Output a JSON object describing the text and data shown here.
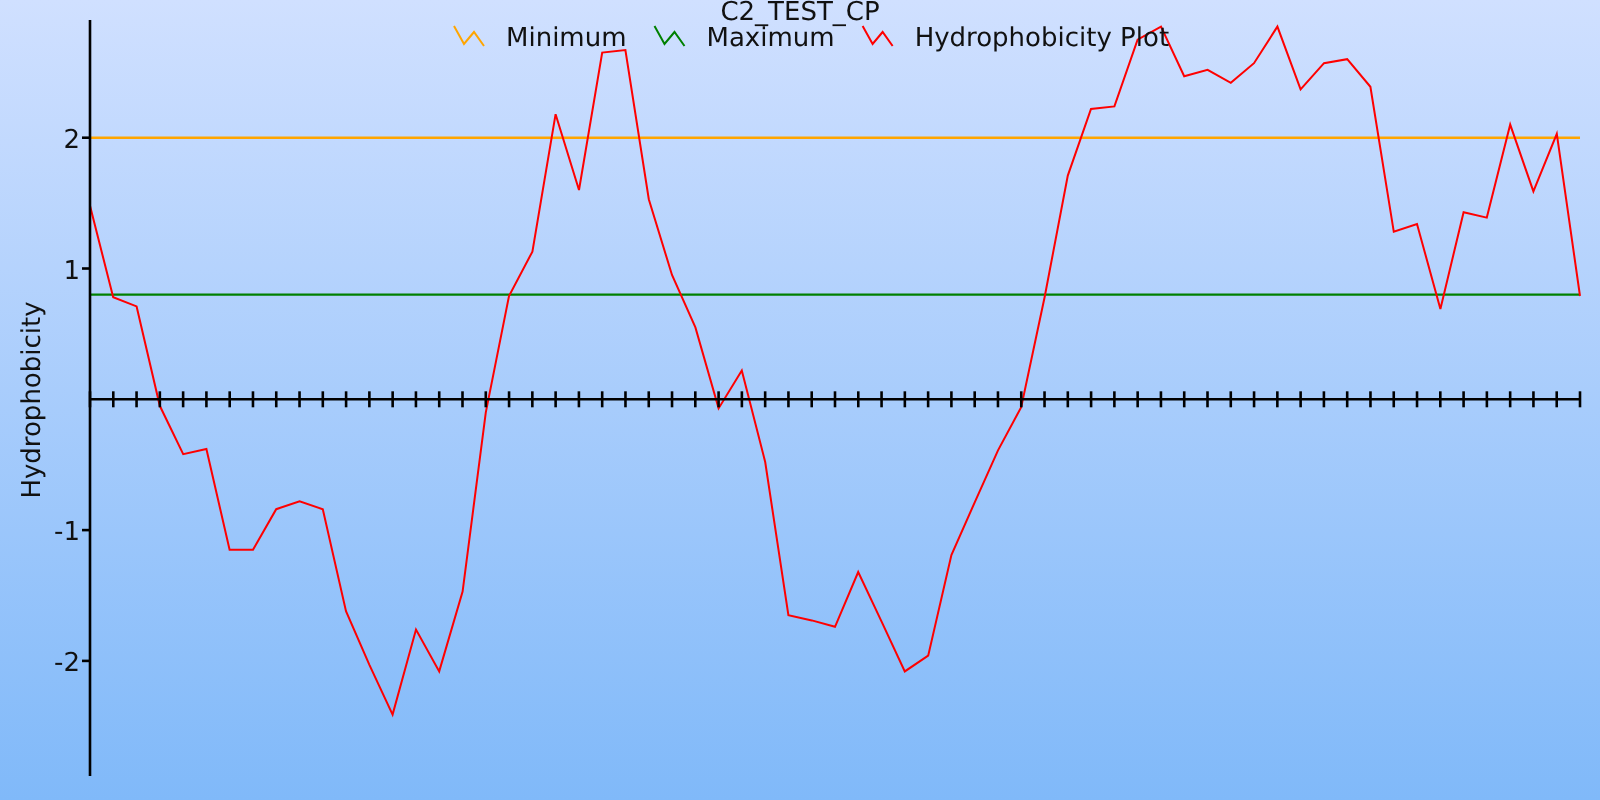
{
  "chart_data": {
    "type": "line",
    "title": "C2_TEST_CP",
    "ylabel": "Hydrophobicity",
    "categories": [
      null,
      null,
      null,
      null,
      null,
      null,
      null,
      null,
      null,
      null,
      null,
      null,
      null,
      null,
      null,
      null,
      null,
      null,
      null,
      null,
      null,
      null,
      null,
      null,
      null,
      null,
      null,
      null,
      null,
      null,
      null,
      null,
      null,
      null,
      null,
      null,
      null,
      null,
      null,
      null,
      null,
      null,
      null,
      null,
      null,
      null,
      null,
      null,
      null,
      null,
      null,
      null,
      null,
      null,
      null,
      null,
      null,
      null,
      null,
      null,
      null,
      null,
      null,
      null,
      null
    ],
    "ylim": [
      -2.88,
      2.9
    ],
    "legend": "top",
    "yticks": [
      -2,
      -1,
      1,
      2
    ],
    "series": [
      {
        "name": "Minimum",
        "color": "#ffa500",
        "values": [
          2,
          2,
          2,
          2,
          2,
          2,
          2,
          2,
          2,
          2,
          2,
          2,
          2,
          2,
          2,
          2,
          2,
          2,
          2,
          2,
          2,
          2,
          2,
          2,
          2,
          2,
          2,
          2,
          2,
          2,
          2,
          2,
          2,
          2,
          2,
          2,
          2,
          2,
          2,
          2,
          2,
          2,
          2,
          2,
          2,
          2,
          2,
          2,
          2,
          2,
          2,
          2,
          2,
          2,
          2,
          2,
          2,
          2,
          2,
          2,
          2,
          2,
          2,
          2,
          2
        ]
      },
      {
        "name": "Maximum",
        "color": "#008000",
        "values": [
          0.8,
          0.8,
          0.8,
          0.8,
          0.8,
          0.8,
          0.8,
          0.8,
          0.8,
          0.8,
          0.8,
          0.8,
          0.8,
          0.8,
          0.8,
          0.8,
          0.8,
          0.8,
          0.8,
          0.8,
          0.8,
          0.8,
          0.8,
          0.8,
          0.8,
          0.8,
          0.8,
          0.8,
          0.8,
          0.8,
          0.8,
          0.8,
          0.8,
          0.8,
          0.8,
          0.8,
          0.8,
          0.8,
          0.8,
          0.8,
          0.8,
          0.8,
          0.8,
          0.8,
          0.8,
          0.8,
          0.8,
          0.8,
          0.8,
          0.8,
          0.8,
          0.8,
          0.8,
          0.8,
          0.8,
          0.8,
          0.8,
          0.8,
          0.8,
          0.8,
          0.8,
          0.8,
          0.8,
          0.8,
          0.8
        ]
      },
      {
        "name": "Hydrophobicity Plot",
        "color": "#ff0000",
        "values": [
          1.48,
          0.78,
          0.71,
          -0.05,
          -0.42,
          -0.38,
          -1.15,
          -1.15,
          -0.84,
          -0.78,
          -0.84,
          -1.62,
          -2.03,
          -2.41,
          -1.76,
          -2.08,
          -1.47,
          -0.1,
          0.79,
          1.13,
          2.18,
          1.6,
          2.65,
          2.67,
          1.53,
          0.95,
          0.55,
          -0.07,
          0.22,
          -0.48,
          -1.65,
          -1.69,
          -1.74,
          -1.32,
          -1.7,
          -2.08,
          -1.96,
          -1.19,
          -0.79,
          -0.39,
          -0.06,
          0.78,
          1.71,
          2.22,
          2.24,
          2.75,
          2.85,
          2.47,
          2.52,
          2.42,
          2.57,
          2.85,
          2.37,
          2.57,
          2.6,
          2.39,
          1.28,
          1.34,
          0.69,
          1.43,
          1.39,
          2.1,
          1.59,
          2.03,
          0.79
        ]
      }
    ]
  }
}
